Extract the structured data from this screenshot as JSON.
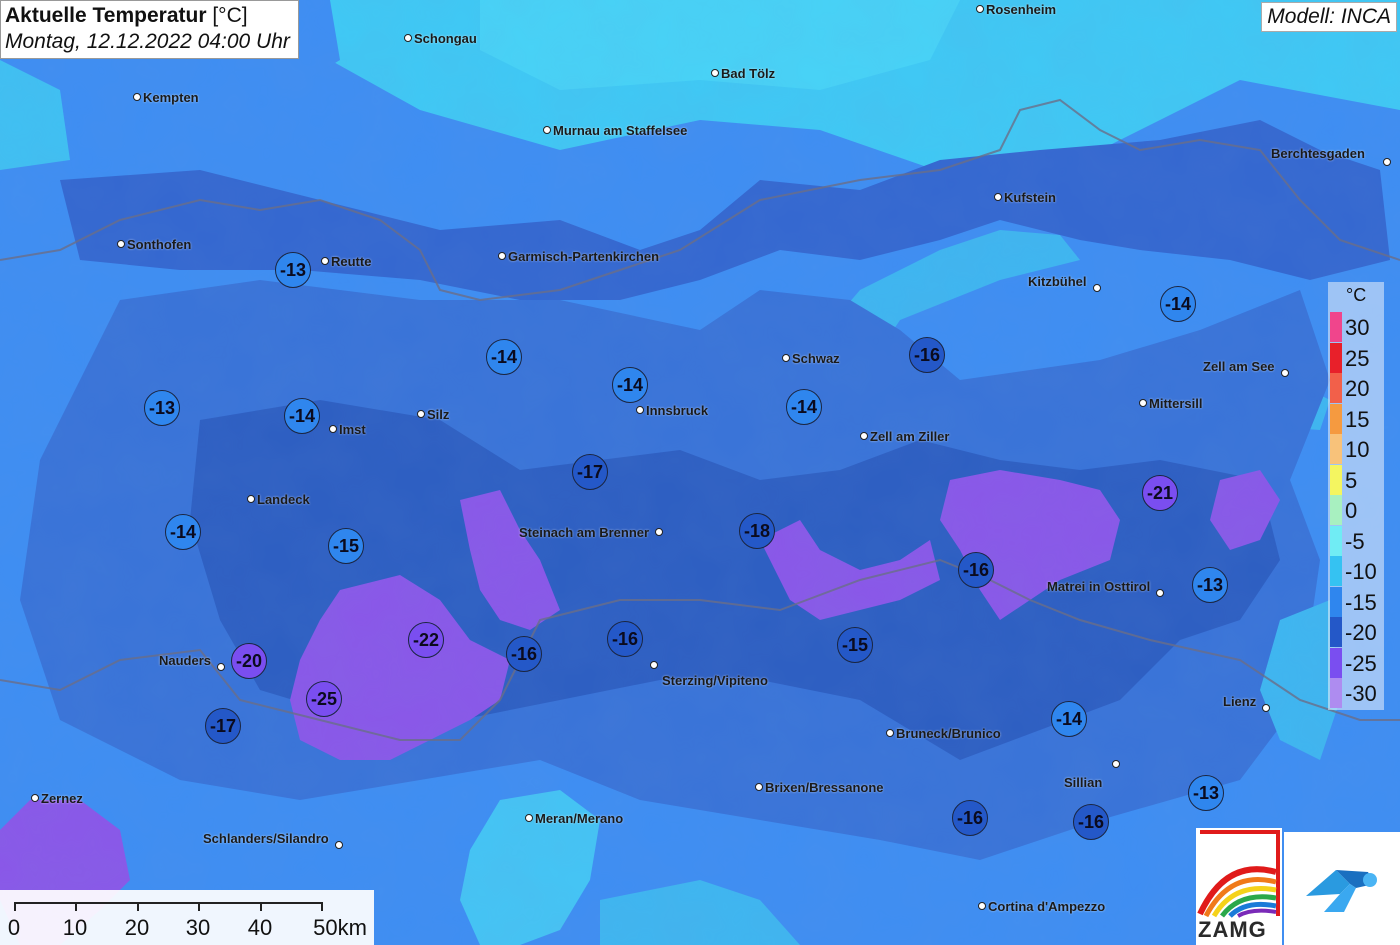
{
  "title": {
    "main": "Aktuelle Temperatur",
    "unit": "[°C]",
    "date": "Montag, 12.12.2022 04:00 Uhr"
  },
  "model": "Modell: INCA",
  "cities": [
    {
      "name": "Rosenheim"
    },
    {
      "name": "Schongau"
    },
    {
      "name": "Bad Tölz"
    },
    {
      "name": "Kempten"
    },
    {
      "name": "Murnau am Staffelsee"
    },
    {
      "name": "Berchtesgaden"
    },
    {
      "name": "Kufstein"
    },
    {
      "name": "Sonthofen"
    },
    {
      "name": "Reutte"
    },
    {
      "name": "Garmisch-Partenkirchen"
    },
    {
      "name": "Kitzbühel"
    },
    {
      "name": "Schwaz"
    },
    {
      "name": "Zell am See"
    },
    {
      "name": "Imst"
    },
    {
      "name": "Silz"
    },
    {
      "name": "Innsbruck"
    },
    {
      "name": "Mittersill"
    },
    {
      "name": "Zell am Ziller"
    },
    {
      "name": "Landeck"
    },
    {
      "name": "Steinach am Brenner"
    },
    {
      "name": "Matrei in Osttirol"
    },
    {
      "name": "Nauders"
    },
    {
      "name": "Sterzing/Vipiteno"
    },
    {
      "name": "Lienz"
    },
    {
      "name": "Bruneck/Brunico"
    },
    {
      "name": "Sillian"
    },
    {
      "name": "Brixen/Bressanone"
    },
    {
      "name": "Zernez"
    },
    {
      "name": "Meran/Merano"
    },
    {
      "name": "Schlanders/Silandro"
    },
    {
      "name": "Cortina d'Ampezzo"
    }
  ],
  "temperatures": [
    "-13",
    "-14",
    "-14",
    "-16",
    "-13",
    "-14",
    "-14",
    "-14",
    "-17",
    "-21",
    "-14",
    "-18",
    "-15",
    "-16",
    "-13",
    "-22",
    "-20",
    "-16",
    "-16",
    "-15",
    "-25",
    "-17",
    "-14",
    "-13",
    "-16",
    "-16"
  ],
  "legend": {
    "unit": "°C",
    "items": [
      {
        "label": "30",
        "color": "#f0458c"
      },
      {
        "label": "25",
        "color": "#e8202a"
      },
      {
        "label": "20",
        "color": "#f2604a"
      },
      {
        "label": "15",
        "color": "#f59a40"
      },
      {
        "label": "10",
        "color": "#f8c27a"
      },
      {
        "label": "5",
        "color": "#f4f560"
      },
      {
        "label": "0",
        "color": "#a8f0c0"
      },
      {
        "label": "-5",
        "color": "#70ecf4"
      },
      {
        "label": "-10",
        "color": "#35c2f2"
      },
      {
        "label": "-15",
        "color": "#2f86ee"
      },
      {
        "label": "-20",
        "color": "#2458c8"
      },
      {
        "label": "-25",
        "color": "#7a4ef0"
      },
      {
        "label": "-30",
        "color": "#ae8cf0"
      }
    ]
  },
  "scale": {
    "labels": [
      "0",
      "10",
      "20",
      "30",
      "40",
      "50km"
    ]
  },
  "logo": {
    "text": "ZAMG"
  }
}
